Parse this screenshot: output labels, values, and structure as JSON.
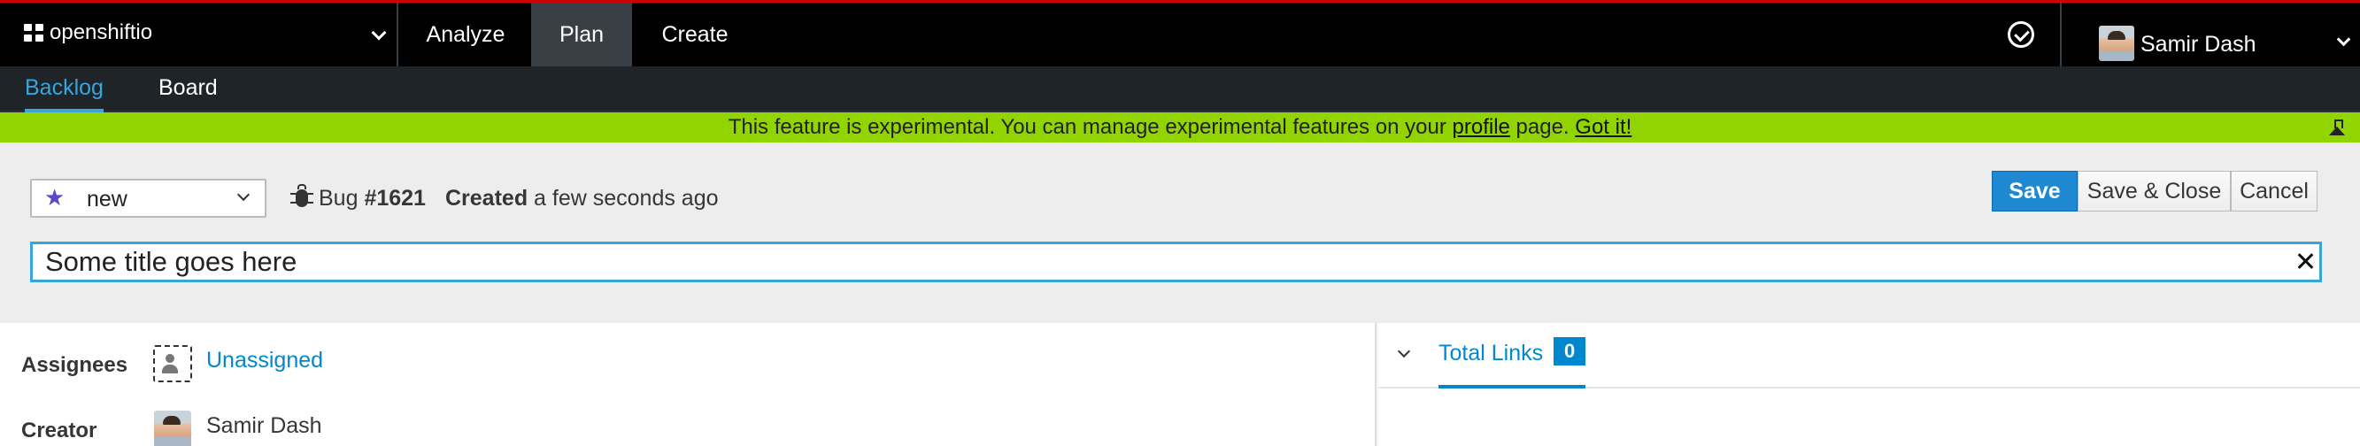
{
  "masthead": {
    "project": "openshiftio",
    "nav": [
      {
        "label": "Analyze"
      },
      {
        "label": "Plan"
      },
      {
        "label": "Create"
      }
    ],
    "user_name": "Samir Dash"
  },
  "subnav": {
    "items": [
      {
        "label": "Backlog"
      },
      {
        "label": "Board"
      }
    ]
  },
  "banner": {
    "text_before": "This feature is experimental. You can manage experimental features on your ",
    "profile_link": "profile",
    "text_after": " page. ",
    "got_it_link": "Got it!"
  },
  "work_item": {
    "state": "new",
    "type": "Bug",
    "number": "#1621",
    "created_label": "Created",
    "created_time": "a few seconds ago",
    "title": "Some title goes here"
  },
  "actions": {
    "save": "Save",
    "save_close": "Save & Close",
    "cancel": "Cancel"
  },
  "details": {
    "assignees_label": "Assignees",
    "assignees_value": "Unassigned",
    "creator_label": "Creator",
    "creator_name": "Samir Dash"
  },
  "links": {
    "label": "Total Links",
    "count": "0"
  },
  "colors": {
    "banner": "#92d400",
    "accent": "#0088ce",
    "save_button": "#1e88d2",
    "masthead": "#000000",
    "state_star": "#6347c9"
  }
}
